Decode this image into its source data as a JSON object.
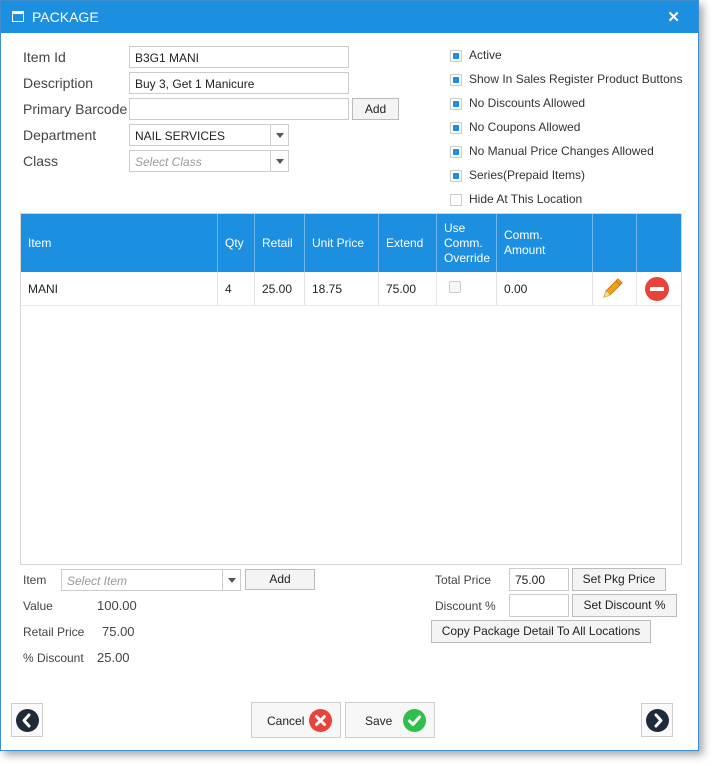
{
  "window": {
    "title": "PACKAGE",
    "close_glyph": "✕"
  },
  "form": {
    "item_id": {
      "label": "Item Id",
      "value": "B3G1 MANI"
    },
    "description": {
      "label": "Description",
      "value": "Buy 3, Get 1 Manicure"
    },
    "primary_barcode": {
      "label": "Primary Barcode",
      "value": "",
      "add_label": "Add"
    },
    "department": {
      "label": "Department",
      "value": "NAIL SERVICES"
    },
    "class": {
      "label": "Class",
      "placeholder": "Select Class"
    }
  },
  "options": [
    {
      "label": "Active",
      "checked": true
    },
    {
      "label": "Show In Sales Register Product Buttons",
      "checked": true
    },
    {
      "label": "No Discounts Allowed",
      "checked": true
    },
    {
      "label": "No Coupons Allowed",
      "checked": true
    },
    {
      "label": "No Manual Price Changes Allowed",
      "checked": true
    },
    {
      "label": "Series(Prepaid Items)",
      "checked": true
    },
    {
      "label": "Hide At This Location",
      "checked": false
    }
  ],
  "grid": {
    "headers": {
      "item": "Item",
      "qty": "Qty",
      "retail": "Retail",
      "unit_price": "Unit Price",
      "extend": "Extend",
      "use_comm_override": "Use Comm. Override",
      "comm_amount": "Comm. Amount"
    },
    "rows": [
      {
        "item": "MANI",
        "qty": "4",
        "retail": "25.00",
        "unit_price": "18.75",
        "extend": "75.00",
        "use_comm_override": false,
        "comm_amount": "0.00"
      }
    ]
  },
  "bottom": {
    "item_label": "Item",
    "item_placeholder": "Select Item",
    "add_label": "Add",
    "value_label": "Value",
    "value": "100.00",
    "retail_price_label": "Retail Price",
    "retail_price": "75.00",
    "pct_discount_label": "% Discount",
    "pct_discount": "25.00",
    "total_price_label": "Total Price",
    "total_price": "75.00",
    "set_pkg_price_label": "Set Pkg Price",
    "discount_pct_label": "Discount %",
    "discount_pct": "",
    "set_discount_label": "Set Discount %",
    "copy_label": "Copy Package Detail To All Locations"
  },
  "footer": {
    "cancel_label": "Cancel",
    "save_label": "Save"
  },
  "colors": {
    "accent": "#1d8fe1",
    "cancel": "#e8433a",
    "save": "#2fbf4d",
    "remove": "#e8433a",
    "edit": "#f0a21b"
  }
}
